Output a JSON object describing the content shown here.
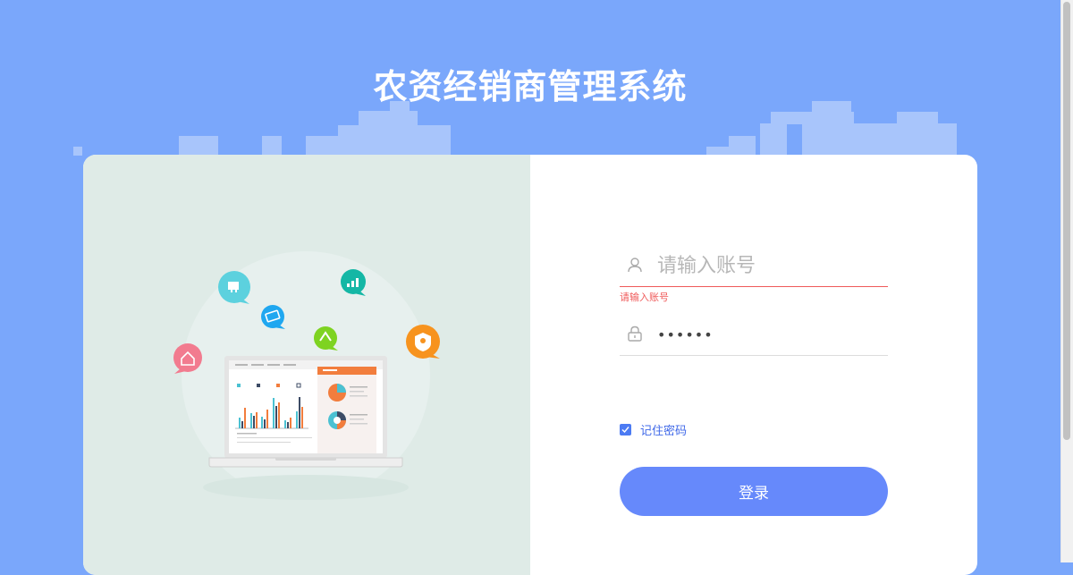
{
  "app": {
    "title": "农资经销商管理系统"
  },
  "login": {
    "username_placeholder": "请输入账号",
    "username_value": "",
    "username_error": "请输入账号",
    "password_value": "••••••",
    "remember_label": "记住密码",
    "remember_checked": true,
    "submit_label": "登录"
  },
  "icons": {
    "user": "user-icon",
    "lock": "lock-icon",
    "check": "check-icon"
  },
  "colors": {
    "background": "#7aa7fb",
    "primary_button": "#6689fb",
    "checkbox": "#4c7bf3",
    "error": "#ef5a5a",
    "illustration_panel": "#dfebe7"
  }
}
